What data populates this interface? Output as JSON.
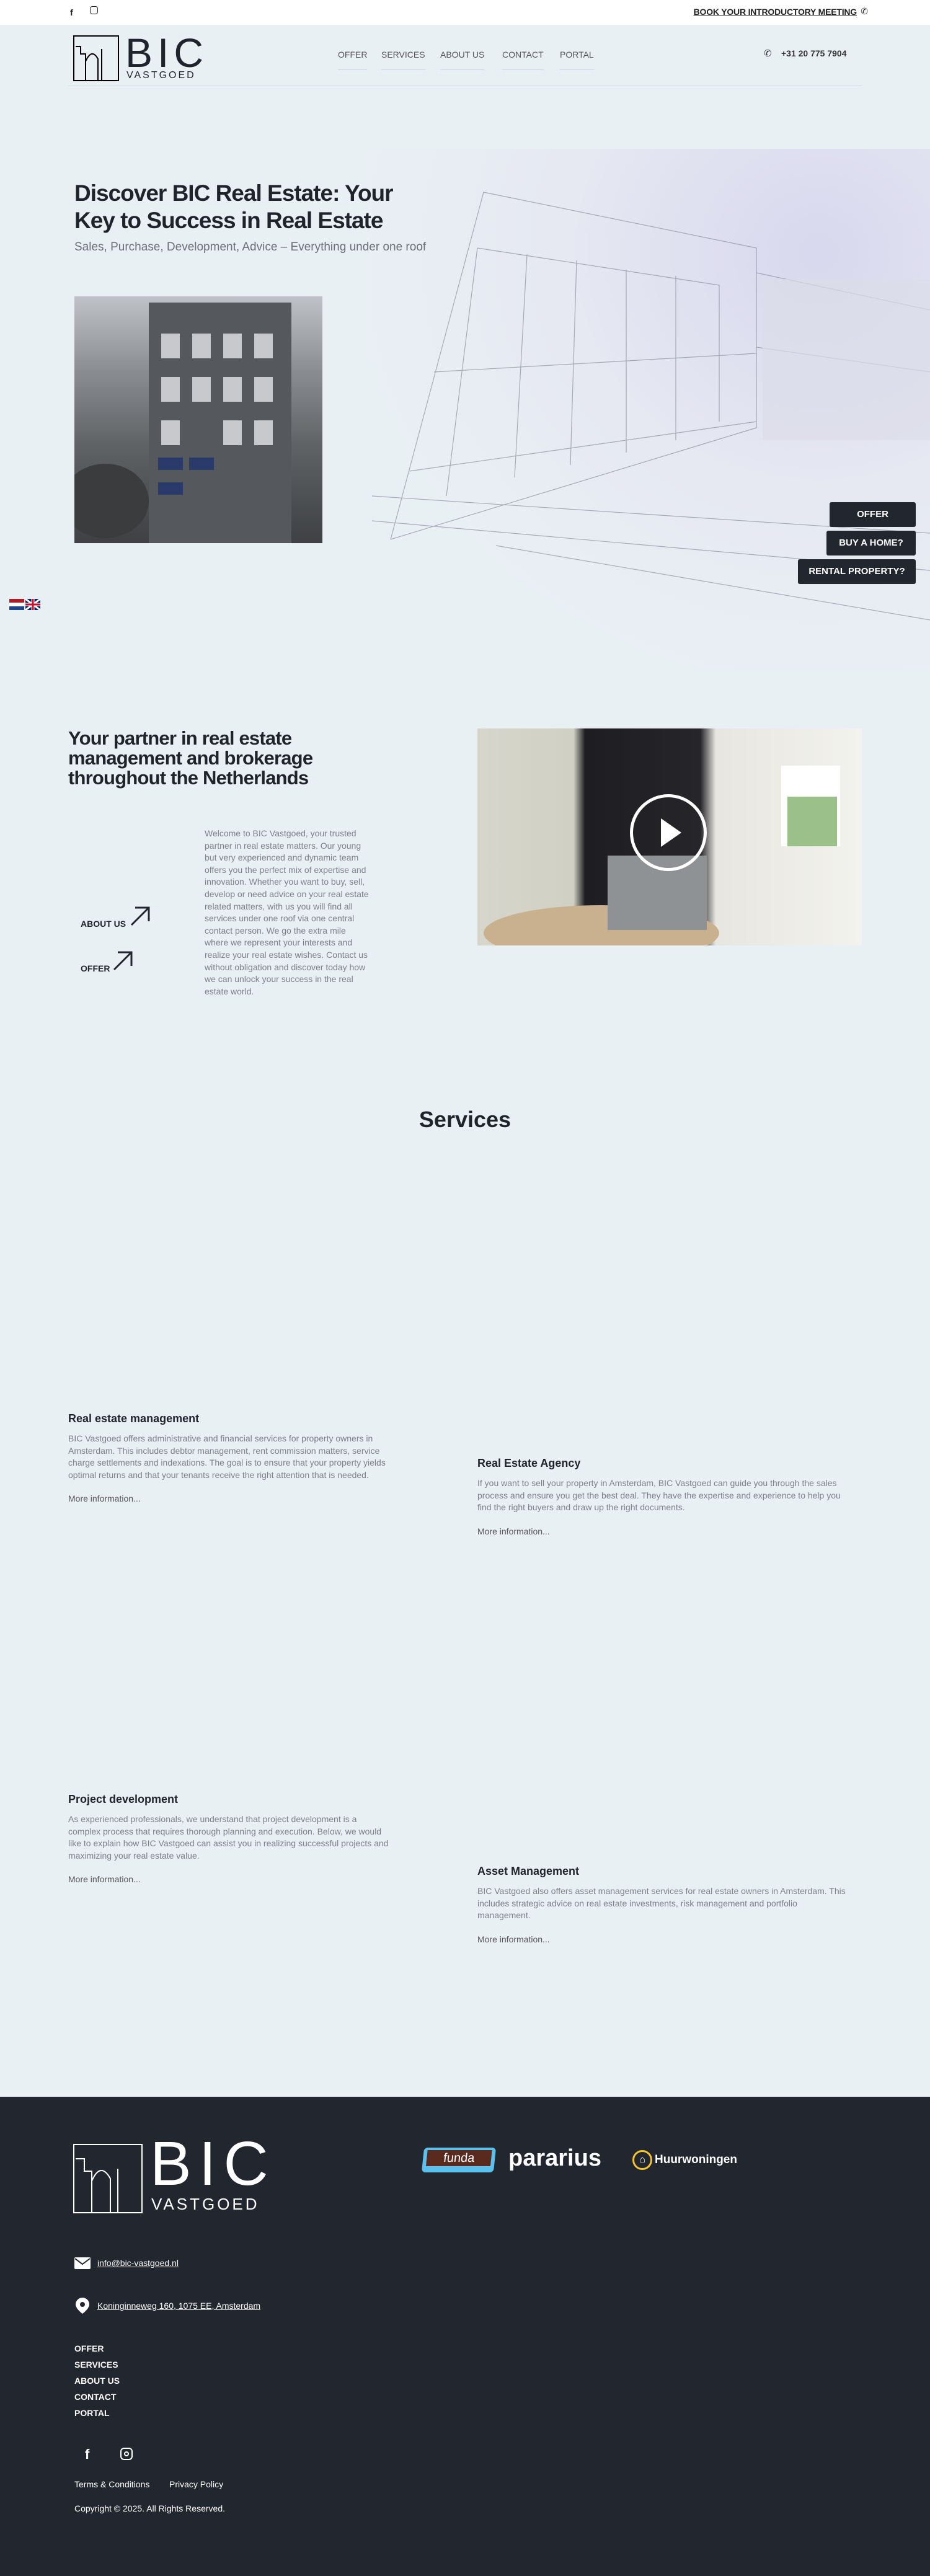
{
  "topbar": {
    "book_label": "BOOK YOUR INTRODUCTORY MEETING"
  },
  "brand": {
    "name": "BIC",
    "sub": "VASTGOED"
  },
  "nav": [
    "OFFER",
    "SERVICES",
    "ABOUT US",
    "CONTACT",
    "PORTAL"
  ],
  "header": {
    "phone": "+31 20 775 7904"
  },
  "hero": {
    "title": "Discover BIC Real Estate: Your Key to Success in Real Estate",
    "subtitle": "Sales, Purchase, Development, Advice – Everything under one roof",
    "buttons": [
      "OFFER",
      "BUY A HOME?",
      "RENTAL PROPERTY?"
    ]
  },
  "about": {
    "title": "Your partner in real estate management and brokerage throughout the Netherlands",
    "links": [
      "ABOUT US",
      "OFFER"
    ],
    "text": "Welcome to BIC Vastgoed, your trusted partner in real estate matters. Our young but very experienced and dynamic team offers you the perfect mix of expertise and innovation. Whether you want to buy, sell, develop or need advice on your real estate related matters, with us you will find all services under one roof via one central contact person. We go the extra mile where we represent your interests and realize your real estate wishes. Contact us without obligation and discover today how we can unlock your success in the real estate world."
  },
  "services": {
    "title": "Services",
    "items": [
      {
        "title": "Real estate management",
        "text": "BIC Vastgoed offers administrative and financial services for property owners in Amsterdam. This includes debtor management, rent commission matters, service charge settlements and indexations. The goal is to ensure that your property yields optimal returns and that your tenants receive the right attention that is needed.",
        "more": "More information..."
      },
      {
        "title": "Real Estate Agency",
        "text": "If you want to sell your property in Amsterdam, BIC Vastgoed can guide you through the sales process and ensure you get the best deal. They have the expertise and experience to help you find the right buyers and draw up the right documents.",
        "more": "More information..."
      },
      {
        "title": "Project development",
        "text": "As experienced professionals, we understand that project development is a complex process that requires thorough planning and execution. Below, we would like to explain how BIC Vastgoed can assist you in realizing successful projects and maximizing your real estate value.",
        "more": "More information..."
      },
      {
        "title": "Asset Management",
        "text": "BIC Vastgoed also offers asset management services for real estate owners in Amsterdam. This includes strategic advice on real estate investments, risk management and portfolio management.",
        "more": "More information..."
      }
    ]
  },
  "footer": {
    "partners": [
      "funda",
      "pararius",
      "Huurwoningen"
    ],
    "email": "info@bic-vastgoed.nl",
    "address": "Koninginneweg 160, 1075 EE, Amsterdam",
    "nav": [
      "OFFER",
      "SERVICES",
      "ABOUT US",
      "CONTACT",
      "PORTAL"
    ],
    "terms": "Terms & Conditions",
    "privacy": "Privacy Policy",
    "copyright": "Copyright © 2025. All Rights Reserved."
  },
  "colors": {
    "dark": "#22262f",
    "background": "#e9f0f4",
    "funda_blue": "#5bc0eb",
    "funda_brown": "#5a2a1e",
    "huur_yellow": "#f4c330"
  }
}
